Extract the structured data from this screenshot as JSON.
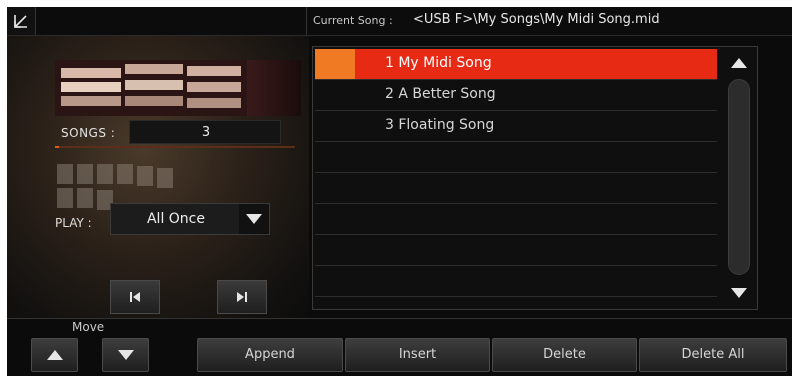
{
  "header": {
    "current_song_label": "Current Song :",
    "current_song_value": "<USB F>\\My Songs\\My Midi Song.mid"
  },
  "left_panel": {
    "songs_label": "SONGS :",
    "songs_count": "3",
    "play_label": "PLAY :",
    "play_mode": "All Once"
  },
  "playlist": {
    "items": [
      {
        "label": "1 My Midi Song",
        "selected": true
      },
      {
        "label": "2 A Better Song",
        "selected": false
      },
      {
        "label": "3 Floating Song",
        "selected": false
      }
    ],
    "empty_rows": 5
  },
  "bottom": {
    "move_label": "Move",
    "append_label": "Append",
    "insert_label": "Insert",
    "delete_label": "Delete",
    "delete_all_label": "Delete All"
  },
  "colors": {
    "selected_row": "#e62a14",
    "selected_marker": "#f07a24",
    "background": "#0b0b0b"
  },
  "icons": {
    "exit": "exit-arrow-icon",
    "play_dropdown": "chevron-down-icon",
    "prev": "previous-track-icon",
    "next": "next-track-icon",
    "scroll_up": "triangle-up-icon",
    "scroll_down": "triangle-down-icon",
    "move_up": "triangle-up-icon",
    "move_down": "triangle-down-icon"
  }
}
